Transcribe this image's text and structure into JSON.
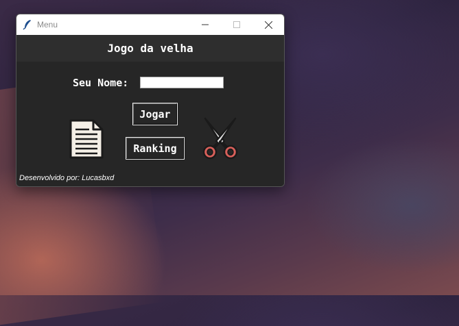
{
  "window": {
    "title": "Menu",
    "title_icon": "feather-icon",
    "controls": [
      "minimize",
      "maximize",
      "close"
    ]
  },
  "header": {
    "title": "Jogo da velha"
  },
  "form": {
    "name_label": "Seu Nome:",
    "name_value": "",
    "name_placeholder": ""
  },
  "buttons": {
    "play_label": "Jogar",
    "ranking_label": "Ranking"
  },
  "icons": {
    "left": "document-icon",
    "right": "scissors-icon"
  },
  "footer": {
    "credit": "Desenvolvido por: Lucasbxd"
  },
  "colors": {
    "window_bg": "#262626",
    "header_bg": "#2e2e2e",
    "text": "#ffffff"
  }
}
